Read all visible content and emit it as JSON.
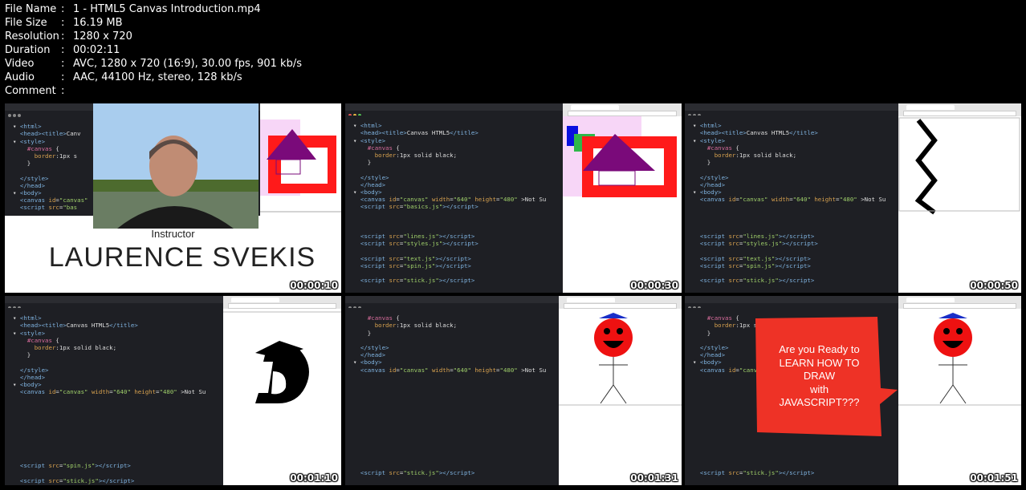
{
  "info": [
    {
      "key": "File Name",
      "value": "1 - HTML5 Canvas Introduction.mp4"
    },
    {
      "key": "File Size",
      "value": "16.19 MB"
    },
    {
      "key": "Resolution",
      "value": "1280 x 720"
    },
    {
      "key": "Duration",
      "value": "00:02:11"
    },
    {
      "key": "Video",
      "value": "AVC, 1280 x 720 (16:9), 30.00 fps, 901 kb/s"
    },
    {
      "key": "Audio",
      "value": "AAC, 44100 Hz, stereo, 128 kb/s"
    },
    {
      "key": "Comment",
      "value": ""
    }
  ],
  "thumbnails": [
    {
      "timestamp": "00:00:10",
      "instructor_caption": "Instructor",
      "instructor_name": "LAURENCE SVEKIS"
    },
    {
      "timestamp": "00:00:30"
    },
    {
      "timestamp": "00:00:50"
    },
    {
      "timestamp": "00:01:10"
    },
    {
      "timestamp": "00:01:31"
    },
    {
      "timestamp": "00:01:51",
      "bubble_lines": [
        "Are you Ready to",
        "LEARN HOW TO",
        "DRAW",
        "with",
        "JAVASCRIPT???"
      ]
    }
  ],
  "colors": {
    "background": "#000000",
    "editor": "#1e1f24",
    "bubble": "#ee3226",
    "canvas_red": "#ff1a1a",
    "triangle": "#7a0a7a"
  }
}
